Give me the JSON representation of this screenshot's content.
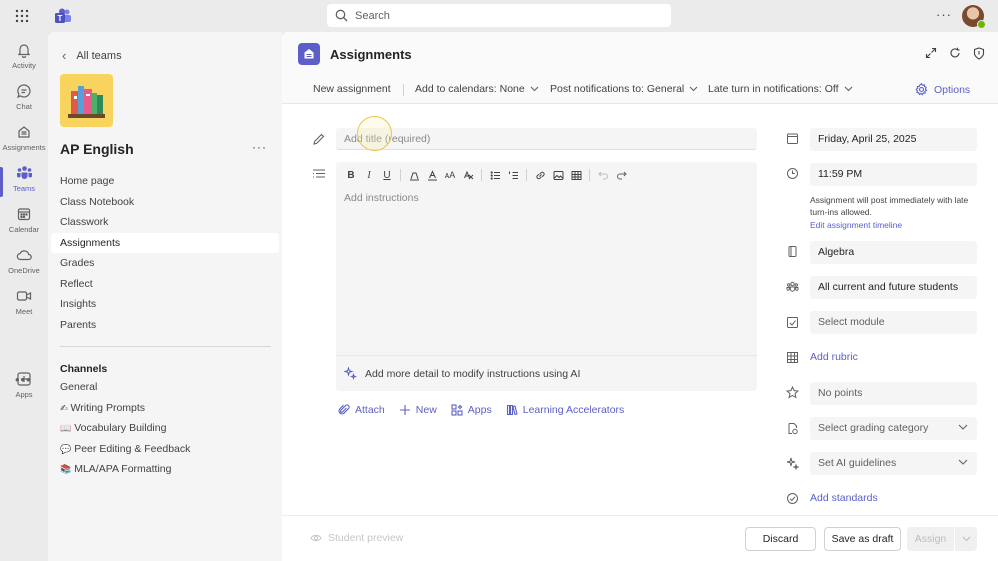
{
  "topbar": {
    "search_placeholder": "Search"
  },
  "rail": {
    "items": [
      {
        "label": "Activity",
        "icon": "bell-icon"
      },
      {
        "label": "Chat",
        "icon": "chat-icon"
      },
      {
        "label": "Assignments",
        "icon": "assignments-icon"
      },
      {
        "label": "Teams",
        "icon": "teams-icon",
        "active": true
      },
      {
        "label": "Calendar",
        "icon": "calendar-icon"
      },
      {
        "label": "OneDrive",
        "icon": "cloud-icon"
      },
      {
        "label": "Meet",
        "icon": "video-icon"
      },
      {
        "label": "Apps",
        "icon": "apps-icon"
      }
    ]
  },
  "teampane": {
    "back_label": "All teams",
    "team_name": "AP English",
    "nav": [
      "Home page",
      "Class Notebook",
      "Classwork",
      "Assignments",
      "Grades",
      "Reflect",
      "Insights",
      "Parents"
    ],
    "active_nav": "Assignments",
    "channels_title": "Channels",
    "channels": [
      {
        "emoji": "",
        "label": "General"
      },
      {
        "emoji": "✍",
        "label": "Writing Prompts"
      },
      {
        "emoji": "📖",
        "label": "Vocabulary Building"
      },
      {
        "emoji": "💬",
        "label": "Peer Editing & Feedback"
      },
      {
        "emoji": "📚",
        "label": "MLA/APA Formatting"
      }
    ]
  },
  "header": {
    "title": "Assignments"
  },
  "toolbar": {
    "new_assignment": "New assignment",
    "add_calendars": "Add to calendars: None",
    "post_notifications": "Post notifications to: General",
    "late_turn_in": "Late turn in notifications: Off",
    "options": "Options"
  },
  "form": {
    "title_placeholder": "Add title (required)",
    "instructions_placeholder": "Add instructions",
    "ai_prompt": "Add more detail to modify instructions using AI",
    "actions": [
      "Attach",
      "New",
      "Apps",
      "Learning Accelerators"
    ]
  },
  "details": {
    "due_date": "Friday, April 25, 2025",
    "due_time": "11:59 PM",
    "post_note": "Assignment will post immediately with late turn-ins allowed.",
    "edit_timeline": "Edit assignment timeline",
    "class": "Algebra",
    "students": "All current and future students",
    "module_placeholder": "Select module",
    "add_rubric": "Add rubric",
    "points_placeholder": "No points",
    "grading_placeholder": "Select grading category",
    "ai_guidelines_placeholder": "Set AI guidelines",
    "add_standards": "Add standards"
  },
  "footer": {
    "student_preview": "Student preview",
    "discard": "Discard",
    "save_draft": "Save as draft",
    "assign": "Assign"
  },
  "colors": {
    "accent": "#5b5fc7",
    "background": "#ebebeb"
  }
}
